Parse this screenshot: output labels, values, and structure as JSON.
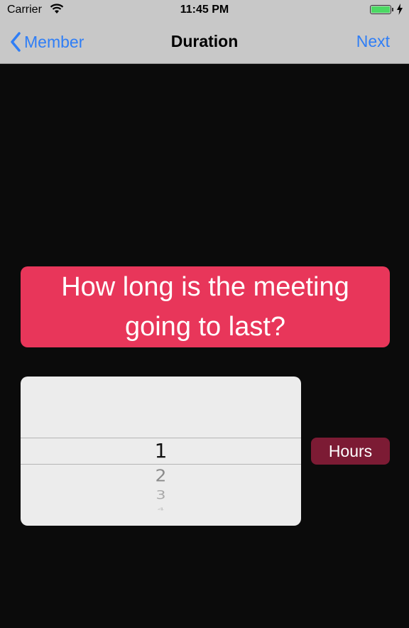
{
  "status_bar": {
    "carrier": "Carrier",
    "time": "11:45 PM",
    "battery_color": "#4cd964"
  },
  "nav": {
    "back_label": "Member",
    "title": "Duration",
    "next_label": "Next",
    "accent_color": "#2f7ef6"
  },
  "question": {
    "text": "How long is the meeting going to last?",
    "background": "#e8365a"
  },
  "picker": {
    "selected": "1",
    "options": [
      "1",
      "2",
      "3",
      "4"
    ]
  },
  "unit": {
    "label": "Hours",
    "background": "#7c1b34"
  },
  "icons": [
    "wifi-icon",
    "battery-icon",
    "charging-bolt-icon",
    "chevron-left-icon"
  ]
}
